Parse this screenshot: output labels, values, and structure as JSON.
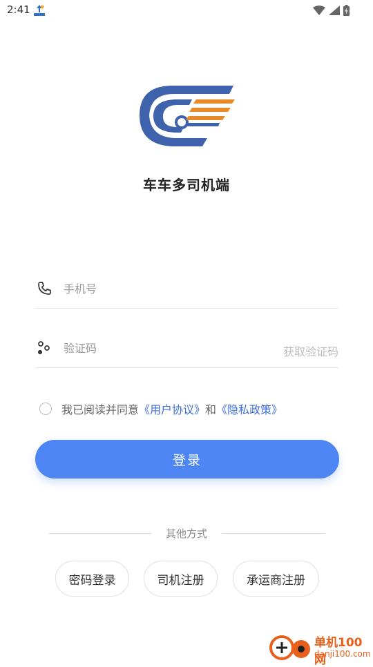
{
  "status_bar": {
    "time": "2:41"
  },
  "app": {
    "title": "车车多司机端"
  },
  "form": {
    "phone_placeholder": "手机号",
    "code_placeholder": "验证码",
    "get_code_label": "获取验证码"
  },
  "agreement": {
    "prefix": "我已阅读并同意",
    "user_agreement": "《用户协议》",
    "and": "和",
    "privacy_policy": "《隐私政策》"
  },
  "login_button": "登录",
  "other_methods": {
    "label": "其他方式",
    "options": [
      "密码登录",
      "司机注册",
      "承运商注册"
    ]
  },
  "watermark": {
    "brand": "单机100网",
    "url": "danji100.com"
  },
  "colors": {
    "primary": "#4d86f3",
    "link": "#3d6fdc",
    "logo_blue": "#3f62ad",
    "logo_orange": "#e8892a"
  }
}
